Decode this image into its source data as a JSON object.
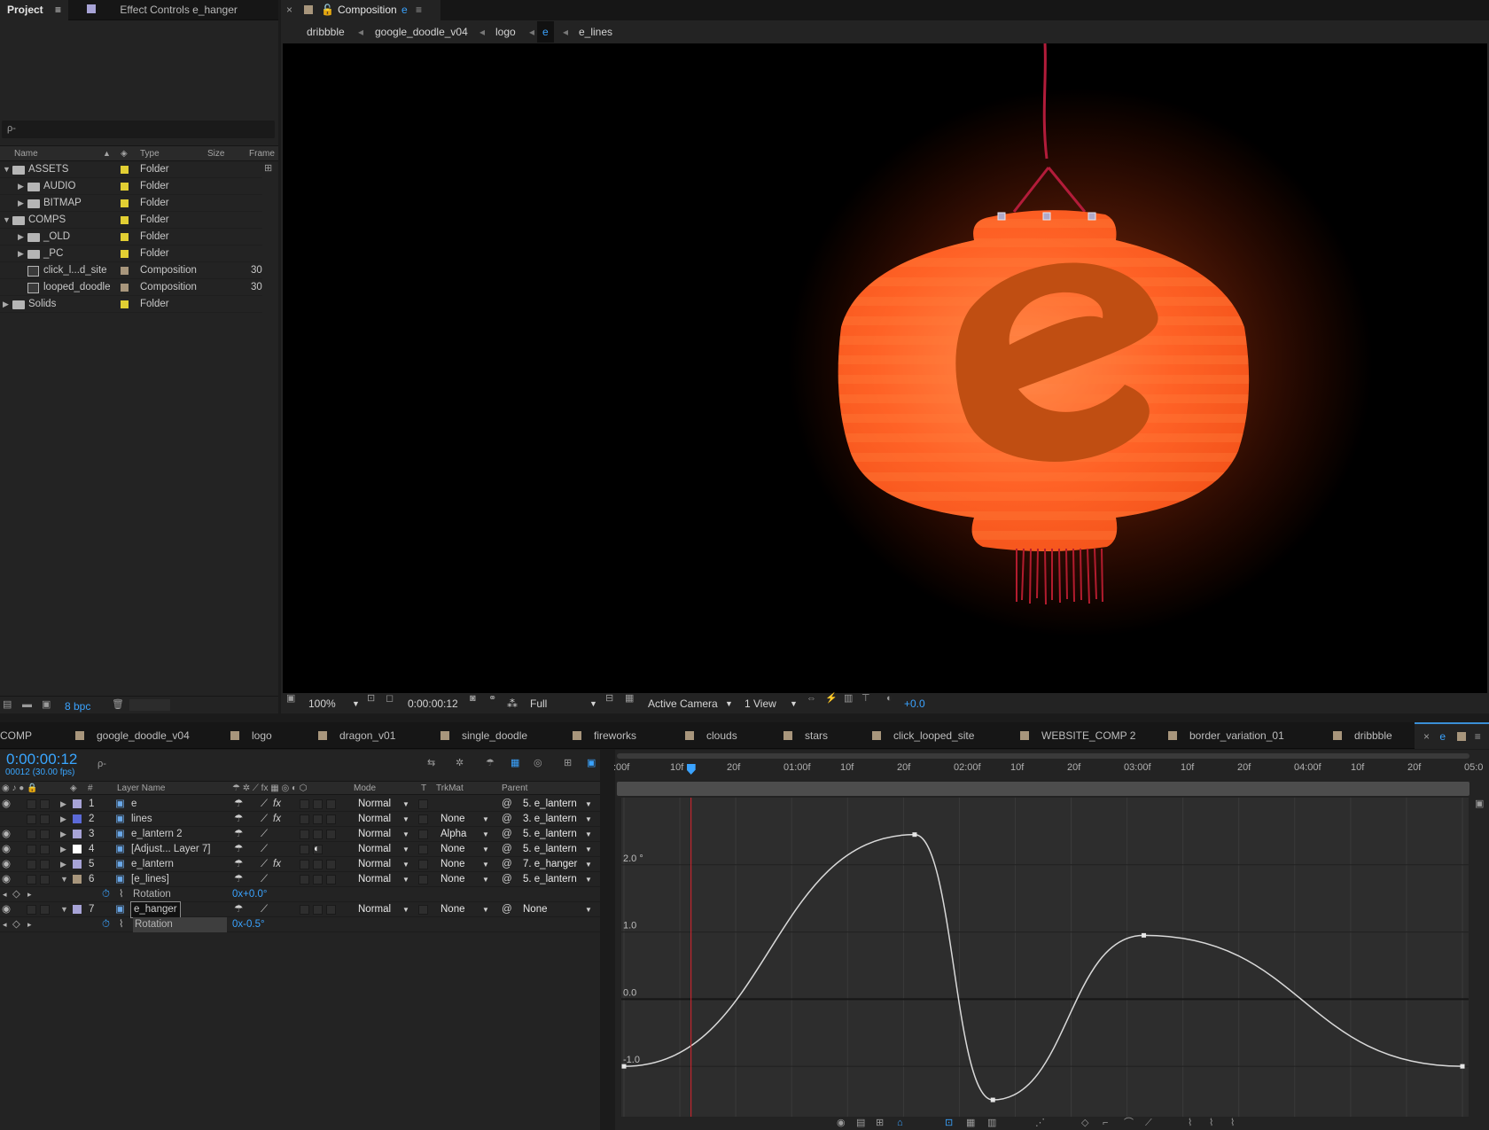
{
  "project_panel": {
    "tab_project": "Project",
    "tab_effect_controls": "Effect Controls e_hanger",
    "search_placeholder": "ρ-",
    "columns": {
      "name": "Name",
      "type": "Type",
      "size": "Size",
      "frame": "Frame"
    },
    "items": [
      {
        "name": "ASSETS",
        "type": "Folder",
        "frame": "",
        "depth": 0,
        "kind": "folder",
        "expanded": true
      },
      {
        "name": "AUDIO",
        "type": "Folder",
        "frame": "",
        "depth": 1,
        "kind": "folder",
        "expanded": false
      },
      {
        "name": "BITMAP",
        "type": "Folder",
        "frame": "",
        "depth": 1,
        "kind": "folder",
        "expanded": false
      },
      {
        "name": "COMPS",
        "type": "Folder",
        "frame": "",
        "depth": 0,
        "kind": "folder",
        "expanded": true
      },
      {
        "name": "_OLD",
        "type": "Folder",
        "frame": "",
        "depth": 1,
        "kind": "folder",
        "expanded": false
      },
      {
        "name": "_PC",
        "type": "Folder",
        "frame": "",
        "depth": 1,
        "kind": "folder",
        "expanded": false
      },
      {
        "name": "click_l...d_site",
        "type": "Composition",
        "frame": "30",
        "depth": 1,
        "kind": "comp",
        "expanded": false
      },
      {
        "name": "looped_doodle",
        "type": "Composition",
        "frame": "30",
        "depth": 1,
        "kind": "comp",
        "expanded": false
      },
      {
        "name": "Solids",
        "type": "Folder",
        "frame": "",
        "depth": 0,
        "kind": "folder",
        "expanded": false
      }
    ],
    "bit_depth": "8 bpc"
  },
  "comp_panel": {
    "tab_label": "Composition",
    "tab_comp": "e",
    "breadcrumbs": [
      "dribbble",
      "google_doodle_v04",
      "logo",
      "e",
      "e_lines"
    ],
    "footer": {
      "zoom": "100%",
      "timecode": "0:00:00:12",
      "resolution": "Full",
      "camera": "Active Camera",
      "views": "1 View",
      "exposure": "+0.0"
    }
  },
  "timeline_tabs": [
    "COMP",
    "google_doodle_v04",
    "logo",
    "dragon_v01",
    "single_doodle",
    "fireworks",
    "clouds",
    "stars",
    "click_looped_site",
    "WEBSITE_COMP 2",
    "border_variation_01",
    "dribbble",
    "e"
  ],
  "timeline": {
    "current_time": "0:00:00:12",
    "frame_info": "00012 (30.00 fps)",
    "columns": {
      "num": "#",
      "layer_name": "Layer Name",
      "mode": "Mode",
      "t": "T",
      "trkmat": "TrkMat",
      "parent": "Parent"
    },
    "layers": [
      {
        "num": "1",
        "name": "e",
        "mode": "Normal",
        "trkmat": "",
        "parent": "5. e_lantern",
        "color": "#a7a3d6"
      },
      {
        "num": "2",
        "name": "lines",
        "mode": "Normal",
        "trkmat": "None",
        "parent": "3. e_lantern",
        "color": "#5c6ad8"
      },
      {
        "num": "3",
        "name": "e_lantern 2",
        "mode": "Normal",
        "trkmat": "Alpha",
        "parent": "5. e_lantern",
        "color": "#a7a3d6"
      },
      {
        "num": "4",
        "name": "[Adjust... Layer 7]",
        "mode": "Normal",
        "trkmat": "None",
        "parent": "5. e_lantern",
        "color": "#ffffff"
      },
      {
        "num": "5",
        "name": "e_lantern",
        "mode": "Normal",
        "trkmat": "None",
        "parent": "7. e_hanger",
        "color": "#a7a3d6"
      },
      {
        "num": "6",
        "name": "[e_lines]",
        "mode": "Normal",
        "trkmat": "None",
        "parent": "5. e_lantern",
        "color": "#a8967c"
      },
      {
        "num": "7",
        "name": "e_hanger",
        "mode": "Normal",
        "trkmat": "None",
        "parent": "None",
        "color": "#a7a3d6"
      }
    ],
    "rotation_label": "Rotation",
    "rotation_6": "0x+0.0°",
    "rotation_7": "0x-0.5°",
    "ruler_labels": [
      ":00f",
      "10f",
      "20f",
      "01:00f",
      "10f",
      "20f",
      "02:00f",
      "10f",
      "20f",
      "03:00f",
      "10f",
      "20f",
      "04:00f",
      "10f",
      "20f",
      "05:0"
    ],
    "graph_y_labels": [
      "2.0 °",
      "1.0",
      "0.0",
      "-1.0"
    ],
    "graph_curve": {
      "x_frames": [
        0,
        23,
        52,
        66,
        93,
        150
      ],
      "y_degrees": [
        -1.0,
        0.0,
        2.45,
        -1.5,
        0.95,
        -1.0
      ],
      "current_frame": 12,
      "y_range": [
        -1.75,
        3.0
      ]
    }
  },
  "colors": {
    "accent_blue": "#3aa3ff",
    "playhead_red": "#e0262f",
    "lantern_orange": "#ff6a2b",
    "graph_line": "#d9d9d9"
  }
}
